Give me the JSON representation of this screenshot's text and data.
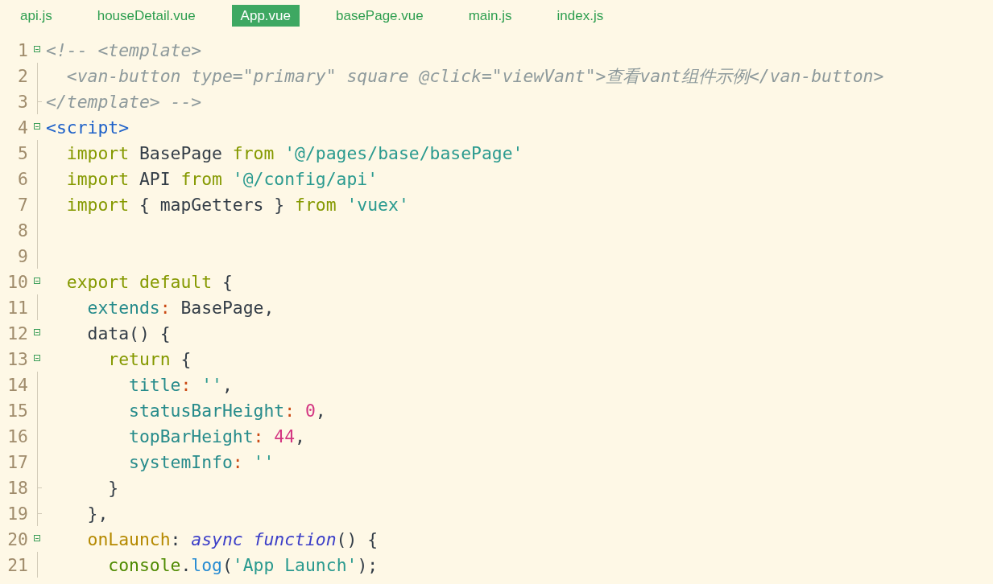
{
  "tabs": [
    {
      "label": "api.js",
      "selected": false
    },
    {
      "label": "houseDetail.vue",
      "selected": false
    },
    {
      "label": "App.vue",
      "selected": true
    },
    {
      "label": "basePage.vue",
      "selected": false
    },
    {
      "label": "main.js",
      "selected": false
    },
    {
      "label": "index.js",
      "selected": false
    }
  ],
  "editor": {
    "lines": [
      {
        "number": "1",
        "fold_marker": true,
        "fold_guide": false,
        "fold_end": false,
        "tokens": [
          {
            "kind": "comment",
            "text": "<!-- <template>"
          }
        ]
      },
      {
        "number": "2",
        "fold_marker": false,
        "fold_guide": true,
        "fold_end": false,
        "tokens": [
          {
            "kind": "comment",
            "text": "  <van-button type=\"primary\" square @click=\"viewVant\">查看vant组件示例</van-button>"
          }
        ]
      },
      {
        "number": "3",
        "fold_marker": false,
        "fold_guide": true,
        "fold_end": true,
        "tokens": [
          {
            "kind": "comment",
            "text": "</template> -->"
          }
        ]
      },
      {
        "number": "4",
        "fold_marker": true,
        "fold_guide": false,
        "fold_end": false,
        "tokens": [
          {
            "kind": "tag",
            "text": "<script>"
          }
        ]
      },
      {
        "number": "5",
        "fold_marker": false,
        "fold_guide": true,
        "fold_end": false,
        "tokens": [
          {
            "kind": "keyword",
            "text": "  import"
          },
          {
            "kind": "plain",
            "text": " BasePage "
          },
          {
            "kind": "keyword",
            "text": "from"
          },
          {
            "kind": "string",
            "text": " '@/pages/base/basePage'"
          }
        ]
      },
      {
        "number": "6",
        "fold_marker": false,
        "fold_guide": true,
        "fold_end": false,
        "tokens": [
          {
            "kind": "keyword",
            "text": "  import"
          },
          {
            "kind": "plain",
            "text": " API "
          },
          {
            "kind": "keyword",
            "text": "from"
          },
          {
            "kind": "string",
            "text": " '@/config/api'"
          }
        ]
      },
      {
        "number": "7",
        "fold_marker": false,
        "fold_guide": true,
        "fold_end": false,
        "tokens": [
          {
            "kind": "keyword",
            "text": "  import"
          },
          {
            "kind": "plain",
            "text": " { mapGetters } "
          },
          {
            "kind": "keyword",
            "text": "from"
          },
          {
            "kind": "string",
            "text": " 'vuex'"
          }
        ]
      },
      {
        "number": "8",
        "fold_marker": false,
        "fold_guide": true,
        "fold_end": false
      },
      {
        "number": "9",
        "fold_marker": false,
        "fold_guide": true,
        "fold_end": false
      },
      {
        "number": "10",
        "fold_marker": true,
        "fold_guide": false,
        "fold_end": false,
        "tokens": [
          {
            "kind": "keyword",
            "text": "  export default"
          },
          {
            "kind": "plain",
            "text": " {"
          }
        ]
      },
      {
        "number": "11",
        "fold_marker": false,
        "fold_guide": true,
        "fold_end": false,
        "tokens": [
          {
            "kind": "property",
            "text": "    extends"
          },
          {
            "kind": "colon",
            "text": ":"
          },
          {
            "kind": "plain",
            "text": " BasePage,"
          }
        ]
      },
      {
        "number": "12",
        "fold_marker": true,
        "fold_guide": false,
        "fold_end": false,
        "tokens": [
          {
            "kind": "plain",
            "text": "    data() {"
          }
        ]
      },
      {
        "number": "13",
        "fold_marker": true,
        "fold_guide": false,
        "fold_end": false,
        "tokens": [
          {
            "kind": "keyword",
            "text": "      return"
          },
          {
            "kind": "plain",
            "text": " {"
          }
        ]
      },
      {
        "number": "14",
        "fold_marker": false,
        "fold_guide": true,
        "fold_end": false,
        "tokens": [
          {
            "kind": "property",
            "text": "        title"
          },
          {
            "kind": "colon",
            "text": ":"
          },
          {
            "kind": "string",
            "text": " ''"
          },
          {
            "kind": "plain",
            "text": ","
          }
        ]
      },
      {
        "number": "15",
        "fold_marker": false,
        "fold_guide": true,
        "fold_end": false,
        "tokens": [
          {
            "kind": "property",
            "text": "        statusBarHeight"
          },
          {
            "kind": "colon",
            "text": ":"
          },
          {
            "kind": "number",
            "text": " 0"
          },
          {
            "kind": "plain",
            "text": ","
          }
        ]
      },
      {
        "number": "16",
        "fold_marker": false,
        "fold_guide": true,
        "fold_end": false,
        "tokens": [
          {
            "kind": "property",
            "text": "        topBarHeight"
          },
          {
            "kind": "colon",
            "text": ":"
          },
          {
            "kind": "number",
            "text": " 44"
          },
          {
            "kind": "plain",
            "text": ","
          }
        ]
      },
      {
        "number": "17",
        "fold_marker": false,
        "fold_guide": true,
        "fold_end": false,
        "tokens": [
          {
            "kind": "property",
            "text": "        systemInfo"
          },
          {
            "kind": "colon",
            "text": ":"
          },
          {
            "kind": "string",
            "text": " ''"
          }
        ]
      },
      {
        "number": "18",
        "fold_marker": false,
        "fold_guide": true,
        "fold_end": true,
        "tokens": [
          {
            "kind": "plain",
            "text": "      }"
          }
        ]
      },
      {
        "number": "19",
        "fold_marker": false,
        "fold_guide": true,
        "fold_end": true,
        "tokens": [
          {
            "kind": "plain",
            "text": "    },"
          }
        ]
      },
      {
        "number": "20",
        "fold_marker": true,
        "fold_guide": false,
        "fold_end": false,
        "tokens": [
          {
            "kind": "method",
            "text": "    onLaunch"
          },
          {
            "kind": "plain",
            "text": ": "
          },
          {
            "kind": "storage",
            "text": "async function"
          },
          {
            "kind": "plain",
            "text": "() {"
          }
        ]
      },
      {
        "number": "21",
        "fold_marker": false,
        "fold_guide": true,
        "fold_end": false,
        "tokens": [
          {
            "kind": "object",
            "text": "      console"
          },
          {
            "kind": "plain",
            "text": "."
          },
          {
            "kind": "call",
            "text": "log"
          },
          {
            "kind": "plain",
            "text": "("
          },
          {
            "kind": "string",
            "text": "'App Launch'"
          },
          {
            "kind": "plain",
            "text": ");"
          }
        ]
      }
    ]
  }
}
